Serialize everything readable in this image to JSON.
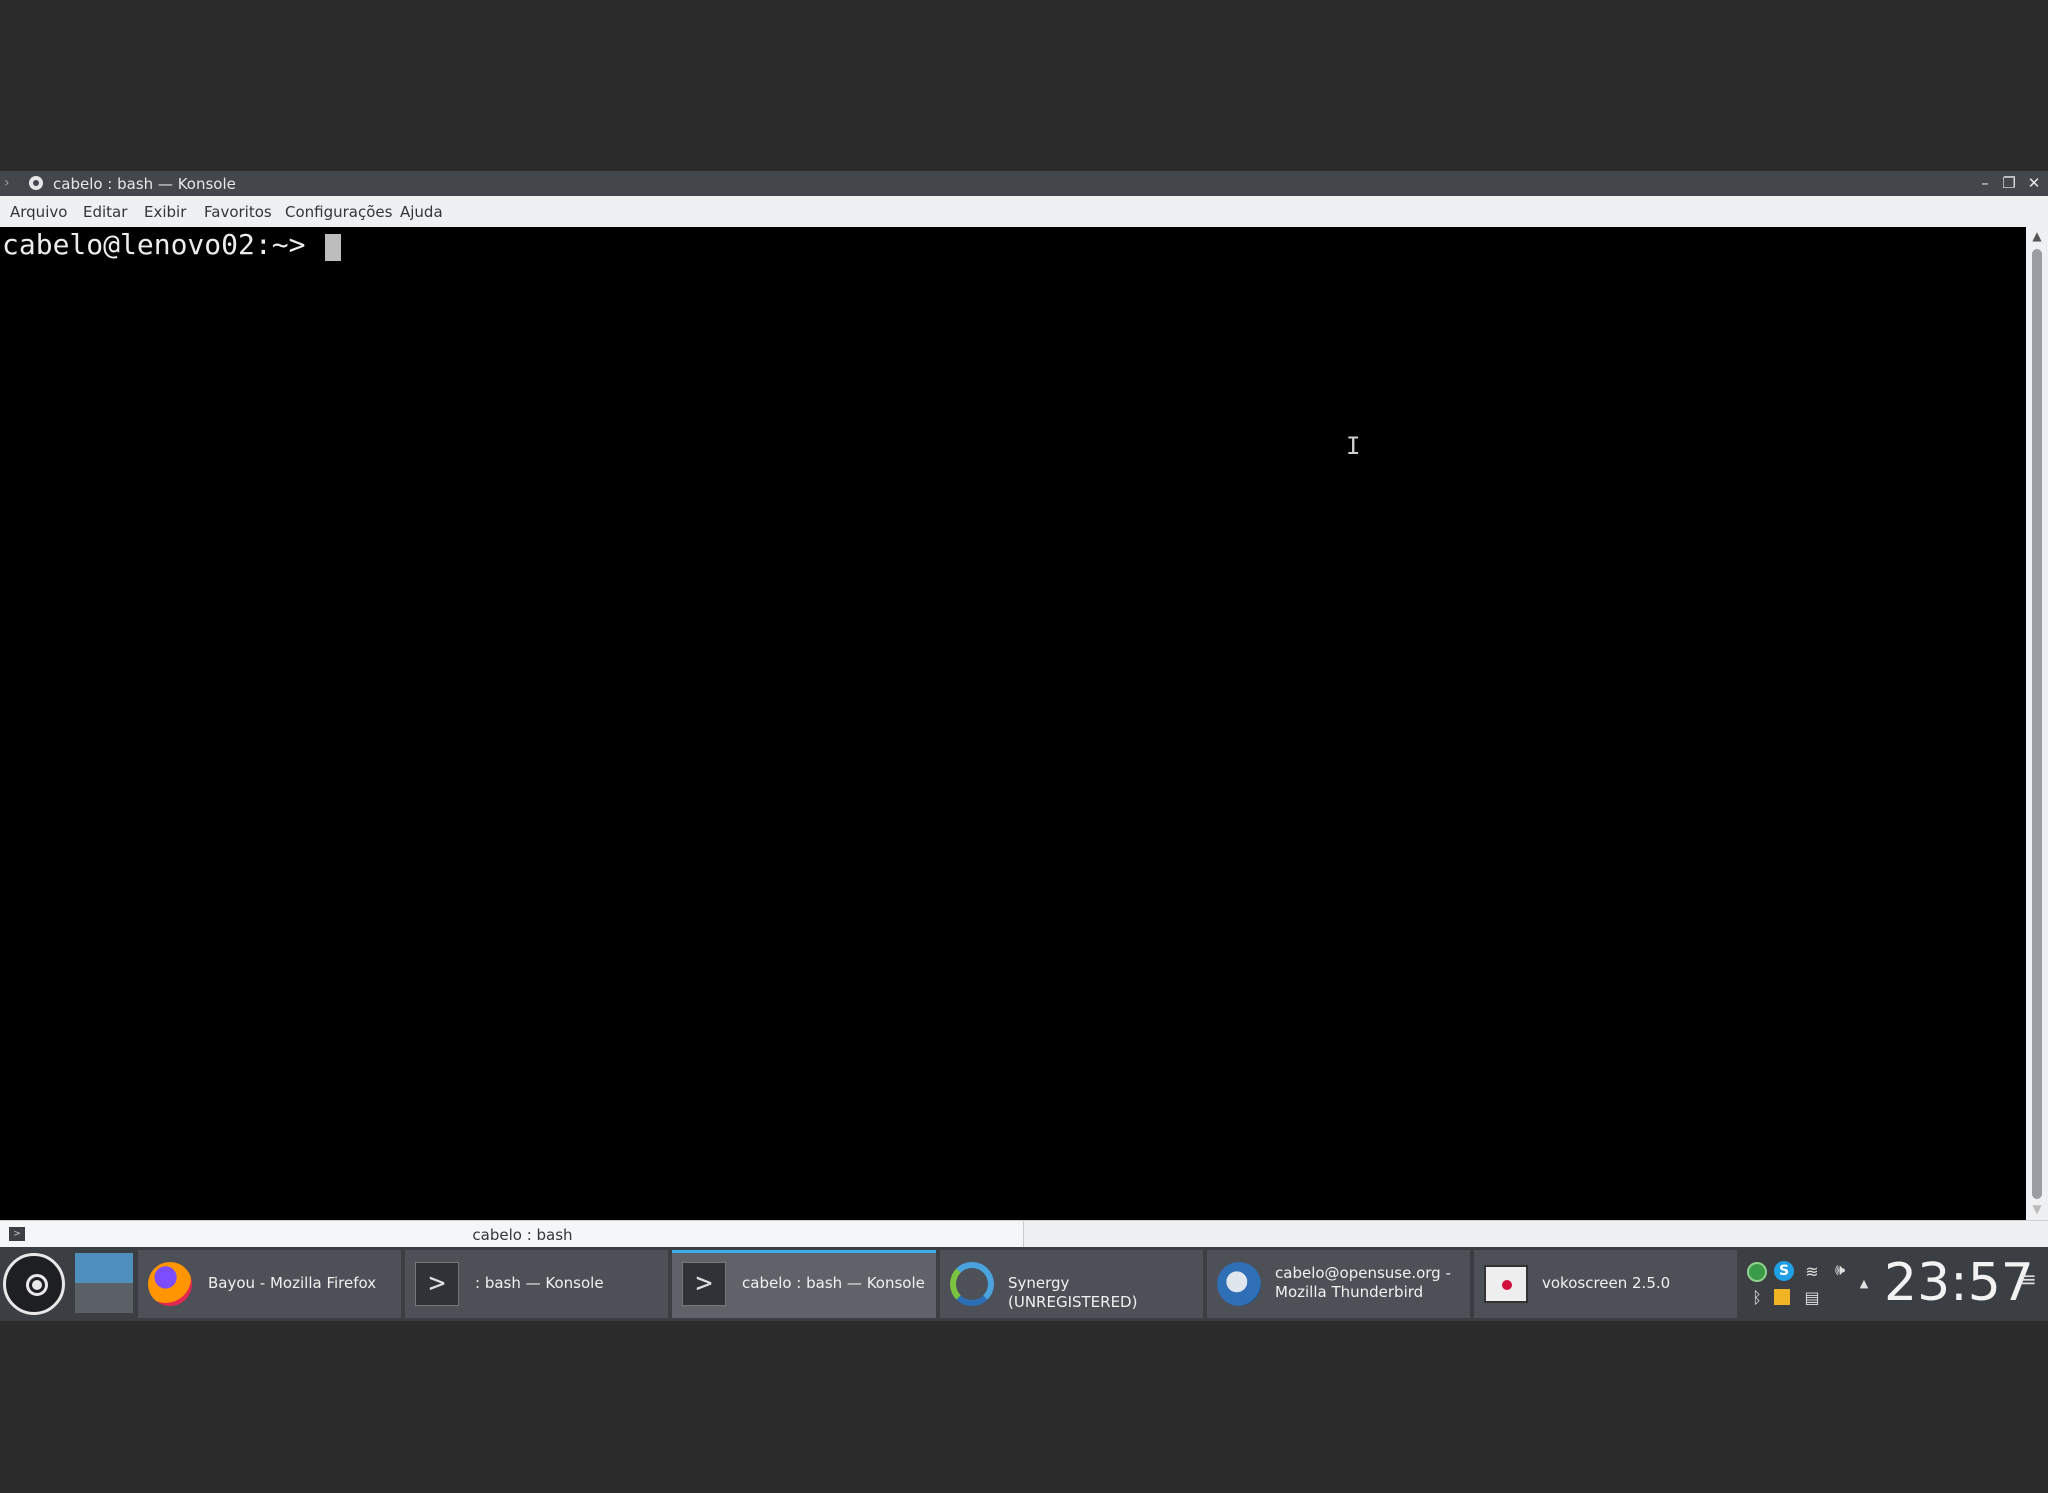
{
  "window": {
    "title": "cabelo : bash — Konsole",
    "controls": {
      "minimize": "–",
      "maximize": "❐",
      "close": "✕"
    }
  },
  "menubar": {
    "items": [
      "Arquivo",
      "Editar",
      "Exibir",
      "Favoritos",
      "Configurações",
      "Ajuda"
    ]
  },
  "terminal": {
    "prompt": "cabelo@lenovo02:~> ",
    "mouse_cursor": "I"
  },
  "scrollbar": {
    "up": "▲",
    "down": "▼"
  },
  "tab": {
    "label": "cabelo : bash",
    "icon_glyph": ">"
  },
  "taskbar": {
    "tasks": [
      {
        "label": "Bayou - Mozilla Firefox",
        "icon": "firefox-icon"
      },
      {
        "label": ": bash — Konsole",
        "icon": "konsole-icon",
        "glyph": ">"
      },
      {
        "label": "cabelo : bash — Konsole",
        "icon": "konsole-icon",
        "glyph": ">",
        "active": true
      },
      {
        "label": "Synergy (UNREGISTERED)",
        "icon": "synergy-icon"
      },
      {
        "label_line1": "cabelo@opensuse.org -",
        "label_line2": "Mozilla Thunderbird",
        "icon": "thunderbird-icon"
      },
      {
        "label": "vokoscreen 2.5.0",
        "icon": "vokoscreen-icon"
      }
    ],
    "tray": {
      "icons": [
        "update-icon",
        "skype-icon",
        "wifi-icon",
        "volume-icon",
        "bluetooth-icon",
        "notes-icon",
        "clipboard-icon",
        "expand-arrow-icon"
      ],
      "glyphs": {
        "wifi": "≋",
        "volume": "🕪",
        "bluetooth": "ᛒ",
        "clipboard": "▤",
        "arrow": "▲",
        "skype": "S"
      }
    },
    "clock": "23:57",
    "menu_glyph": "≡"
  },
  "colors": {
    "accent": "#3daee9",
    "titlebar": "#43464b",
    "taskbar": "#3b3e43",
    "terminal_bg": "#000000"
  }
}
